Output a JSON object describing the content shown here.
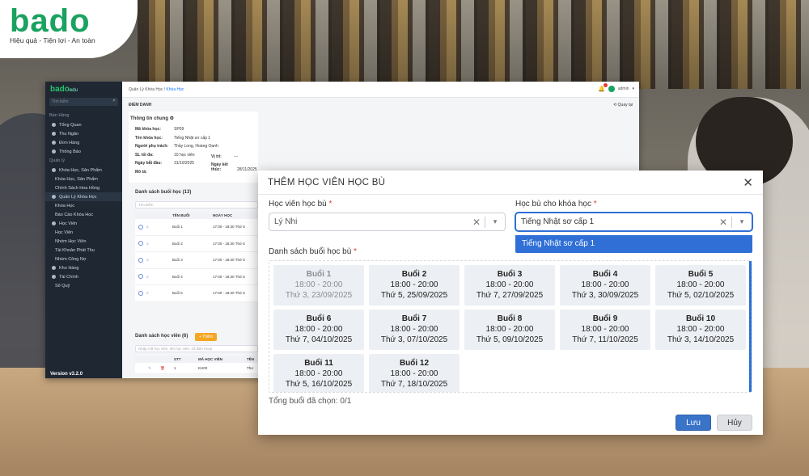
{
  "brand": {
    "logo_text": "bado",
    "tagline": "Hiệu quả - Tiện lợi - An toàn"
  },
  "app": {
    "sidebar": {
      "logo": "bado",
      "logo_sub": "edu",
      "search_placeholder": "Tìm kiếm",
      "section_sales": "Bán Hàng",
      "items_sales": [
        "Tổng Quan",
        "Thu Ngân",
        "Đơn Hàng",
        "Thông Báo"
      ],
      "section_manage": "Quản lý",
      "group_products": "Khóa Học, Sản Phẩm",
      "sub_products": [
        "Khóa Học, Sản Phẩm",
        "Chính Sách Hoa Hồng"
      ],
      "group_courses": "Quản Lý Khóa Học",
      "sub_courses": [
        "Khóa Học",
        "Báo Cáo Khóa Học"
      ],
      "group_students": "Học Viên",
      "sub_students": [
        "Học Viên",
        "Nhóm Học Viên",
        "Tài Khoản Phát Thu",
        "Nhóm Công Nợ"
      ],
      "group_warehouse": "Kho Hàng",
      "group_finance": "Tài Chính",
      "sub_finance": [
        "Sổ Quỹ"
      ],
      "version": "Version v3.2.0"
    },
    "topbar": {
      "crumb_parent": "Quản Lý Khóa Học",
      "crumb_current": "Khóa Học",
      "user": "admin"
    },
    "page": {
      "heading": "ĐIỂM DANH",
      "back": "Quay lại",
      "info_title": "Thông tin chung",
      "info": [
        {
          "k": "Mã khóa học:",
          "v": "SP09"
        },
        {
          "k": "Tên khóa học:",
          "v": "Tiếng Nhật sơ cấp 1"
        },
        {
          "k": "Người phụ trách:",
          "v": "Thầy Long, Hoàng Oanh"
        },
        {
          "k": "SL tối đa:",
          "v": "10 học viên"
        },
        {
          "k": "Ngày bắt đầu:",
          "v": "31/10/2025"
        },
        {
          "k": "Mô tả:",
          "v": ""
        }
      ],
      "info_extra": [
        {
          "k": "Vị trí:",
          "v": "---"
        },
        {
          "k": "Ngày kết thúc:",
          "v": "28/11/2025"
        }
      ],
      "sessions_title": "Danh sách buổi học (13)",
      "sessions_search": "Tìm kiếm",
      "sessions_cols": [
        "TÊN BUỔI",
        "NGÀY HỌC"
      ],
      "sessions_rows": [
        {
          "name": "Buổi 1",
          "time": "17:00 - 18:30 Thứ 6"
        },
        {
          "name": "Buổi 2",
          "time": "17:00 - 18:30 Thứ 6"
        },
        {
          "name": "Buổi 3",
          "time": "17:00 - 18:30 Thứ 6"
        },
        {
          "name": "Buổi 4",
          "time": "17:00 - 18:30 Thứ 6"
        },
        {
          "name": "Buổi 5",
          "time": "17:00 - 18:30 Thứ 6"
        }
      ],
      "students_title": "Danh sách học viên (6)",
      "students_add": "+ Thêm",
      "students_search": "Nhập mã học viên, tên học viên, số điện thoại",
      "students_cols": [
        "STT",
        "MÃ HỌC VIÊN",
        "TÊN"
      ],
      "students_rows": [
        {
          "stt": "1",
          "code": "KH00",
          "name": "Thư"
        }
      ]
    }
  },
  "modal": {
    "title": "THÊM HỌC VIÊN HỌC BÙ",
    "student_label": "Học viên học bù",
    "student_value": "Lý Nhi",
    "course_label": "Học bù cho khóa học",
    "course_value": "Tiếng Nhật sơ cấp 1",
    "course_option": "Tiếng Nhật sơ cấp 1",
    "sessions_label": "Danh sách buổi học bù",
    "sessions": [
      {
        "name": "Buổi 1",
        "time": "18:00 - 20:00",
        "date": "Thứ 3, 23/09/2025",
        "disabled": true
      },
      {
        "name": "Buổi 2",
        "time": "18:00 - 20:00",
        "date": "Thứ 5, 25/09/2025",
        "disabled": false
      },
      {
        "name": "Buổi 3",
        "time": "18:00 - 20:00",
        "date": "Thứ 7, 27/09/2025",
        "disabled": false
      },
      {
        "name": "Buổi 4",
        "time": "18:00 - 20:00",
        "date": "Thứ 3, 30/09/2025",
        "disabled": false
      },
      {
        "name": "Buổi 5",
        "time": "18:00 - 20:00",
        "date": "Thứ 5, 02/10/2025",
        "disabled": false
      },
      {
        "name": "Buổi 6",
        "time": "18:00 - 20:00",
        "date": "Thứ 7, 04/10/2025",
        "disabled": false
      },
      {
        "name": "Buổi 7",
        "time": "18:00 - 20:00",
        "date": "Thứ 3, 07/10/2025",
        "disabled": false
      },
      {
        "name": "Buổi 8",
        "time": "18:00 - 20:00",
        "date": "Thứ 5, 09/10/2025",
        "disabled": false
      },
      {
        "name": "Buổi 9",
        "time": "18:00 - 20:00",
        "date": "Thứ 7, 11/10/2025",
        "disabled": false
      },
      {
        "name": "Buổi 10",
        "time": "18:00 - 20:00",
        "date": "Thứ 3, 14/10/2025",
        "disabled": false
      },
      {
        "name": "Buổi 11",
        "time": "18:00 - 20:00",
        "date": "Thứ 5, 16/10/2025",
        "disabled": false
      },
      {
        "name": "Buổi 12",
        "time": "18:00 - 20:00",
        "date": "Thứ 7, 18/10/2025",
        "disabled": false
      }
    ],
    "total": "Tổng buổi đã chọn: 0/1",
    "save": "Lưu",
    "cancel": "Hủy",
    "accent": "#2f6fd6"
  }
}
